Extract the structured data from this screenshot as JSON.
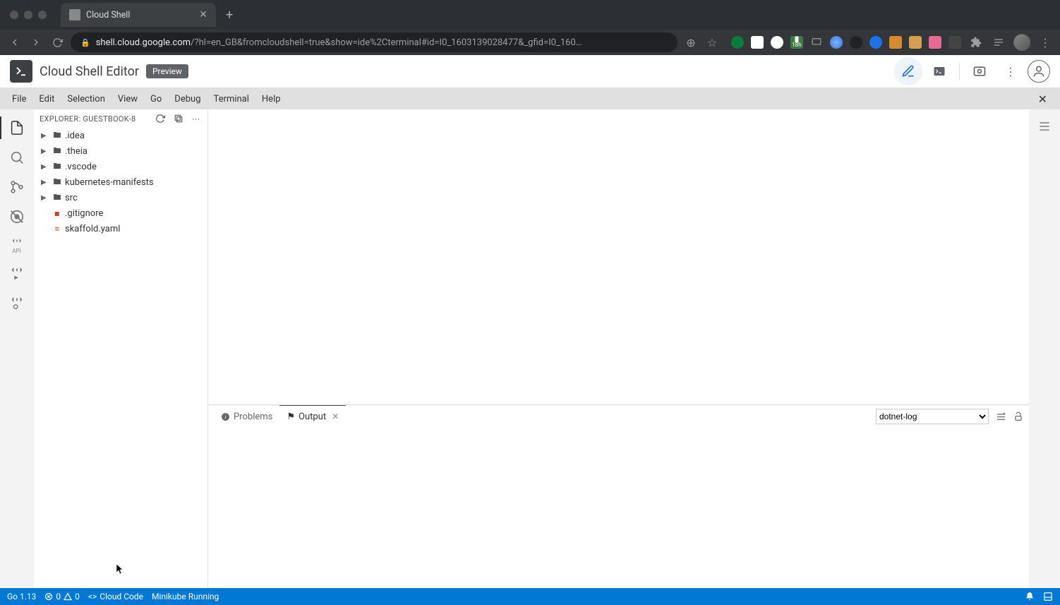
{
  "browser": {
    "tab_title": "Cloud Shell",
    "url_host": "shell.cloud.google.com",
    "url_path": "/?hl=en_GB&fromcloudshell=true&show=ide%2Cterminal#id=I0_1603139028477&_gfid=I0_160…",
    "extensions_badge": "18h"
  },
  "app": {
    "title": "Cloud Shell Editor",
    "badge": "Preview"
  },
  "menu": [
    "File",
    "Edit",
    "Selection",
    "View",
    "Go",
    "Debug",
    "Terminal",
    "Help"
  ],
  "explorer": {
    "label": "EXPLORER: GUESTBOOK-8",
    "tree": [
      {
        "type": "folder",
        "name": ".idea"
      },
      {
        "type": "folder",
        "name": ".theia"
      },
      {
        "type": "folder",
        "name": ".vscode"
      },
      {
        "type": "folder",
        "name": "kubernetes-manifests"
      },
      {
        "type": "folder",
        "name": "src"
      },
      {
        "type": "file",
        "name": ".gitignore",
        "icon": "git"
      },
      {
        "type": "file",
        "name": "skaffold.yaml",
        "icon": "yaml"
      }
    ]
  },
  "panel": {
    "tabs": {
      "problems": "Problems",
      "output": "Output"
    },
    "select_value": "dotnet-log"
  },
  "status": {
    "go": "Go 1.13",
    "errors": "0",
    "warnings": "0",
    "cloud_code": "Cloud Code",
    "minikube": "Minikube Running"
  }
}
